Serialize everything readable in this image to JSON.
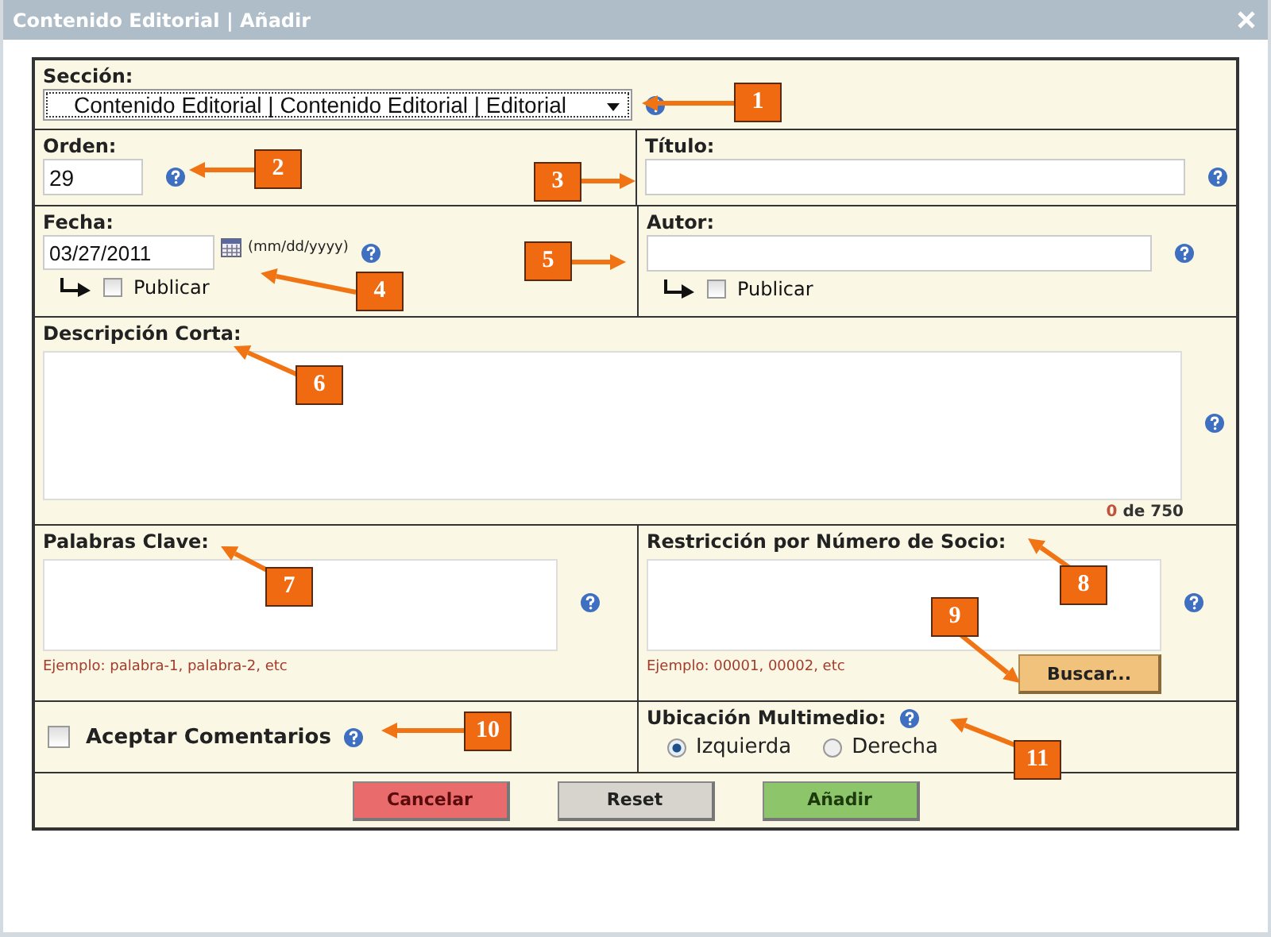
{
  "window": {
    "title": "Contenido Editorial | Añadir"
  },
  "seccion": {
    "label": "Sección:",
    "value": "Contenido Editorial | Contenido Editorial | Editorial"
  },
  "orden": {
    "label": "Orden:",
    "value": "29"
  },
  "titulo": {
    "label": "Título:"
  },
  "fecha": {
    "label": "Fecha:",
    "value": "03/27/2011",
    "format": "(mm/dd/yyyy)",
    "publish": {
      "label": "Publicar",
      "checked": false
    }
  },
  "autor": {
    "label": "Autor:",
    "publish": {
      "label": "Publicar",
      "checked": false
    }
  },
  "descripcion": {
    "label": "Descripción Corta:",
    "count": "0",
    "limit": "de 750"
  },
  "palabras": {
    "label": "Palabras Clave:",
    "hint": "Ejemplo: palabra-1, palabra-2, etc"
  },
  "restriccion": {
    "label": "Restricción por Número de Socio:",
    "hint": "Ejemplo: 00001, 00002, etc",
    "button": "Buscar..."
  },
  "comentarios": {
    "label": "Aceptar Comentarios",
    "checked": false
  },
  "ubicacion": {
    "label": "Ubicación Multimedio:",
    "options": [
      {
        "label": "Izquierda",
        "selected": true
      },
      {
        "label": "Derecha",
        "selected": false
      }
    ]
  },
  "buttons": [
    {
      "label": "Cancelar",
      "kind": "cancel"
    },
    {
      "label": "Reset",
      "kind": "reset"
    },
    {
      "label": "Añadir",
      "kind": "submit"
    }
  ],
  "callouts": [
    "1",
    "2",
    "3",
    "4",
    "5",
    "6",
    "7",
    "8",
    "9",
    "10",
    "11"
  ]
}
